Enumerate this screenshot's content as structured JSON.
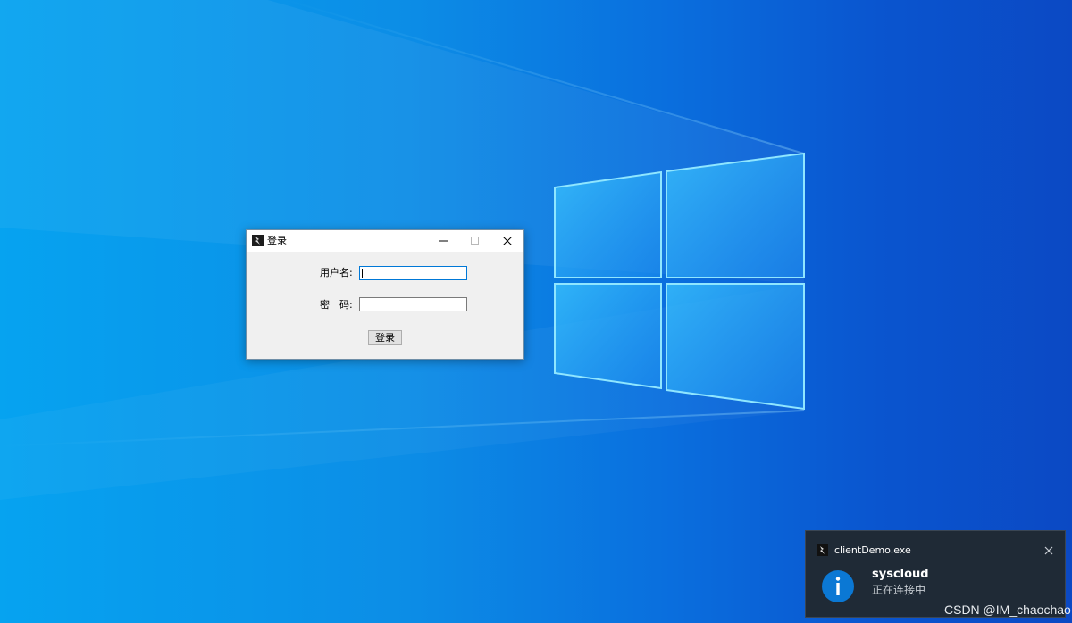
{
  "login_window": {
    "title": "登录",
    "username_label": "用户名:",
    "password_label": "密　码:",
    "username_value": "",
    "password_value": "",
    "login_button_label": "登录"
  },
  "notification": {
    "app_name": "clientDemo.exe",
    "title": "syscloud",
    "message": "正在连接中",
    "icon": "info-icon"
  },
  "watermark": "CSDN @IM_chaochao",
  "colors": {
    "accent": "#0078d7",
    "notification_bg": "#1f2a36",
    "info_icon": "#0b78d4"
  }
}
